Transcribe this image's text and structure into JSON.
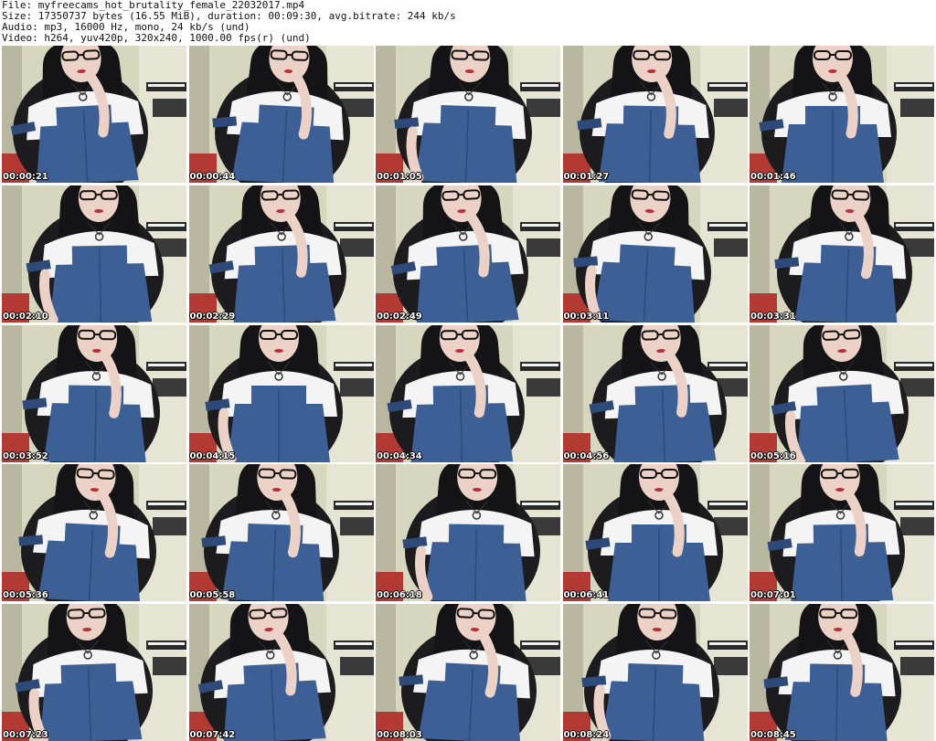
{
  "header": {
    "file_line": "File: myfreecams_hot_brutality_female_22032017.mp4",
    "size_line": "Size: 17350737 bytes (16.55 MiB), duration: 00:09:30, avg.bitrate: 244 kb/s",
    "audio_line": "Audio: mp3, 16000 Hz, mono, 24 kb/s (und)",
    "video_line": "Video: h264, yuv420p, 320x240, 1000.00 fps(r) (und)"
  },
  "thumbnails": [
    {
      "timestamp": "00:00:21"
    },
    {
      "timestamp": "00:00:44"
    },
    {
      "timestamp": "00:01:05"
    },
    {
      "timestamp": "00:01:27"
    },
    {
      "timestamp": "00:01:46"
    },
    {
      "timestamp": "00:02:10"
    },
    {
      "timestamp": "00:02:29"
    },
    {
      "timestamp": "00:02:49"
    },
    {
      "timestamp": "00:03:11"
    },
    {
      "timestamp": "00:03:31"
    },
    {
      "timestamp": "00:03:52"
    },
    {
      "timestamp": "00:04:15"
    },
    {
      "timestamp": "00:04:34"
    },
    {
      "timestamp": "00:04:56"
    },
    {
      "timestamp": "00:05:16"
    },
    {
      "timestamp": "00:05:36"
    },
    {
      "timestamp": "00:05:58"
    },
    {
      "timestamp": "00:06:18"
    },
    {
      "timestamp": "00:06:41"
    },
    {
      "timestamp": "00:07:01"
    },
    {
      "timestamp": "00:07:23"
    },
    {
      "timestamp": "00:07:42"
    },
    {
      "timestamp": "00:08:03"
    },
    {
      "timestamp": "00:08:24"
    },
    {
      "timestamp": "00:08:45"
    }
  ],
  "colors": {
    "wall": "#d7d6bf",
    "dark_wall": "#b9b7a0",
    "chair": "#1c1c1e",
    "hair": "#141416",
    "skin": "#ecd2c6",
    "shirt": "#f4f4f4",
    "denim": "#3c5f96",
    "denim_dark": "#2d4a78",
    "keyboard": "#2a2a2a",
    "floor_red": "#b23a32",
    "timestamp_text": "#ffffff"
  }
}
